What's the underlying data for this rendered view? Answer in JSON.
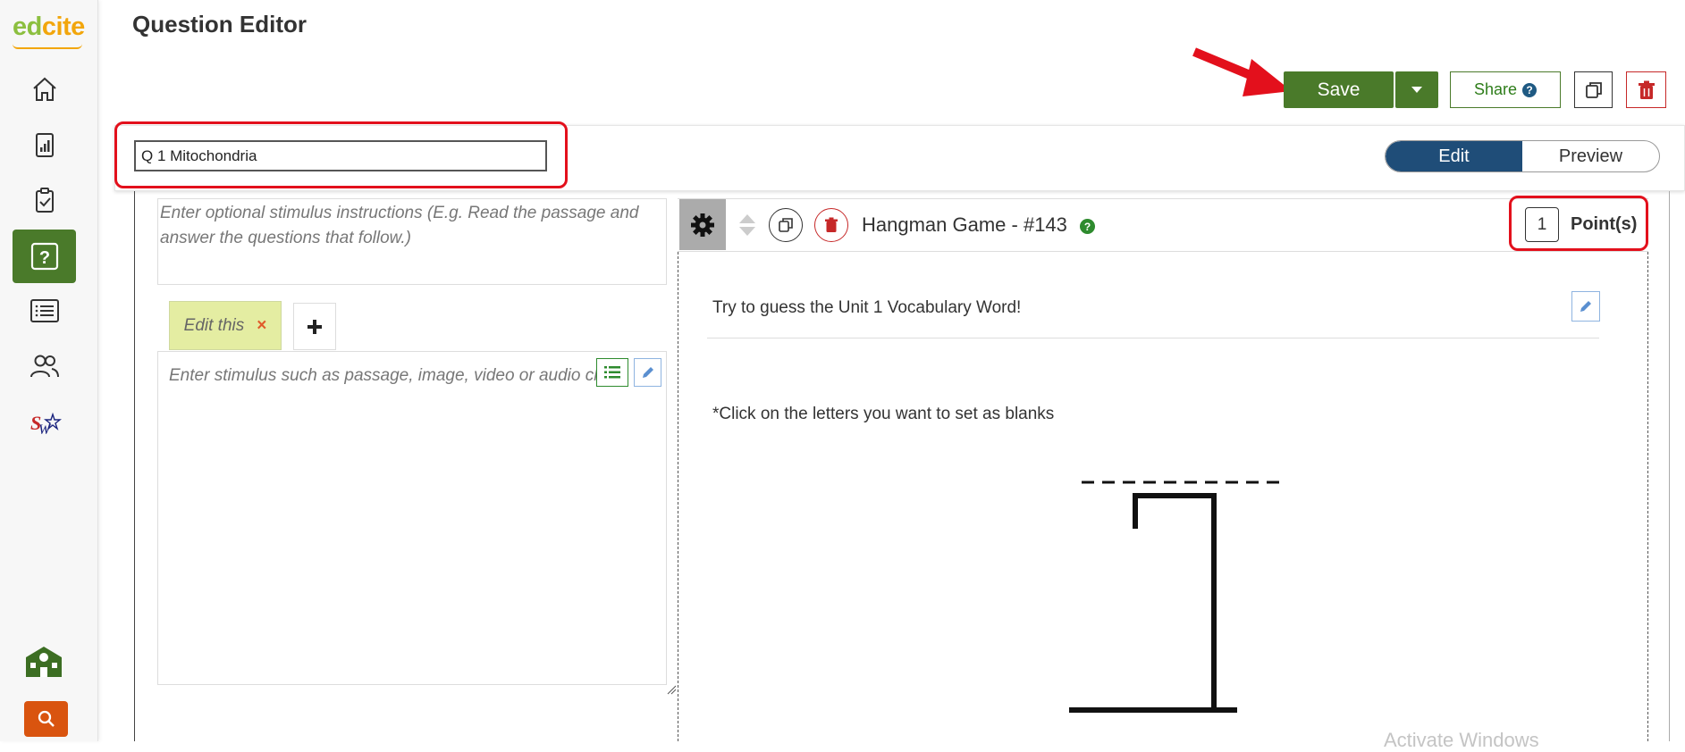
{
  "sidebar": {
    "logo_part1": "ed",
    "logo_part2": "cite"
  },
  "header": {
    "title": "Question Editor"
  },
  "toolbar": {
    "save_label": "Save",
    "share_label": "Share",
    "help_glyph": "?"
  },
  "name_bar": {
    "question_name": "Q 1 Mitochondria",
    "mode_edit": "Edit",
    "mode_preview": "Preview",
    "active_mode": "Edit"
  },
  "stimulus": {
    "instructions_placeholder": "Enter optional stimulus instructions (E.g. Read the passage and answer the questions that follow.)",
    "tab_label": "Edit this",
    "tab_close": "×",
    "content_placeholder": "Enter stimulus such as passage, image, video or audio clip"
  },
  "question": {
    "title": "Hangman Game - #143",
    "help_glyph": "?",
    "points_value": "1",
    "points_label": "Point(s)",
    "prompt": "Try to guess the Unit 1 Vocabulary Word!",
    "instructions": "*Click on the letters you want to set as blanks"
  },
  "overlay": {
    "watermark": "Activate Windows"
  },
  "colors": {
    "brand_green": "#4a7a2a",
    "highlight_red": "#e3101c",
    "toggle_active": "#1f4d78",
    "search_orange": "#d9540f"
  }
}
